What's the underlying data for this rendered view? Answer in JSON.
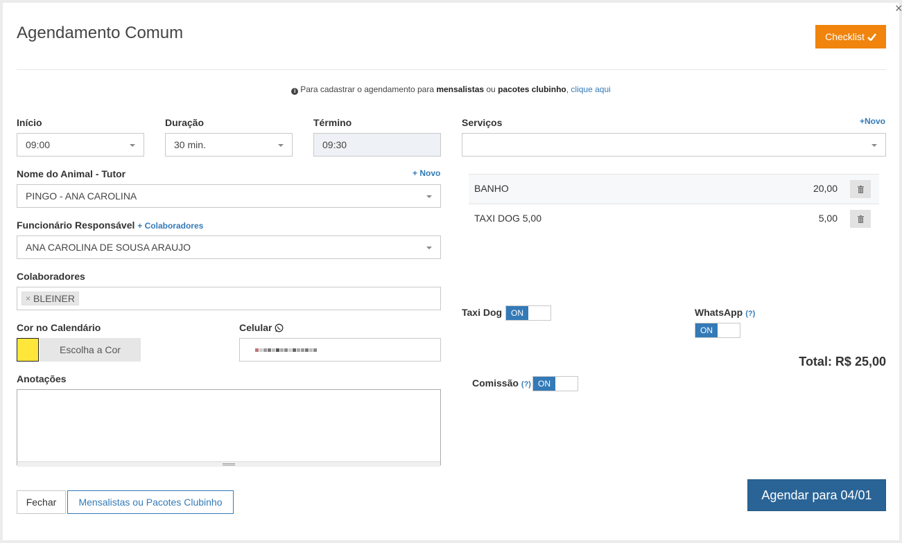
{
  "modal": {
    "title": "Agendamento Comum",
    "close_label": "×",
    "checklist_label": "Checklist"
  },
  "notice": {
    "prefix": "Para cadastrar o agendamento para ",
    "bold1": "mensalistas",
    "middle": " ou ",
    "bold2": "pacotes clubinho",
    "comma": ", ",
    "link": "clique aqui"
  },
  "form": {
    "inicio": {
      "label": "Início",
      "value": "09:00"
    },
    "duracao": {
      "label": "Duração",
      "value": "30 min."
    },
    "termino": {
      "label": "Término",
      "value": "09:30"
    },
    "animal": {
      "label": "Nome do Animal - Tutor",
      "new_link": "+ Novo",
      "value": "PINGO - ANA CAROLINA"
    },
    "funcionario": {
      "label": "Funcionário Responsável",
      "link": "+ Colaboradores",
      "value": "ANA CAROLINA DE SOUSA ARAUJO"
    },
    "colaboradores": {
      "label": "Colaboradores",
      "tags": [
        {
          "remove": "×",
          "name": "BLEINER"
        }
      ]
    },
    "cor": {
      "label": "Cor no Calendário",
      "button": "Escolha a Cor",
      "color": "#ffe63b"
    },
    "celular": {
      "label": "Celular"
    },
    "anotacoes": {
      "label": "Anotações",
      "value": ""
    }
  },
  "servicos": {
    "label": "Serviços",
    "new_link": "+Novo",
    "value": "",
    "items": [
      {
        "name": "BANHO",
        "price": "20,00"
      },
      {
        "name": "TAXI DOG 5,00",
        "price": "5,00"
      }
    ]
  },
  "options": {
    "taxi_dog": {
      "label": "Taxi Dog",
      "state": "ON"
    },
    "whatsapp": {
      "label": "WhatsApp",
      "help": "(?)",
      "state": "ON"
    },
    "comissao": {
      "label": "Comissão",
      "help": "(?)",
      "state": "ON"
    }
  },
  "total": "Total: R$ 25,00",
  "footer": {
    "fechar": "Fechar",
    "mensalistas": "Mensalistas ou Pacotes Clubinho",
    "agendar": "Agendar para 04/01"
  },
  "colors": {
    "primary": "#2a6496",
    "accent": "#f0840c",
    "link": "#337ab7"
  }
}
